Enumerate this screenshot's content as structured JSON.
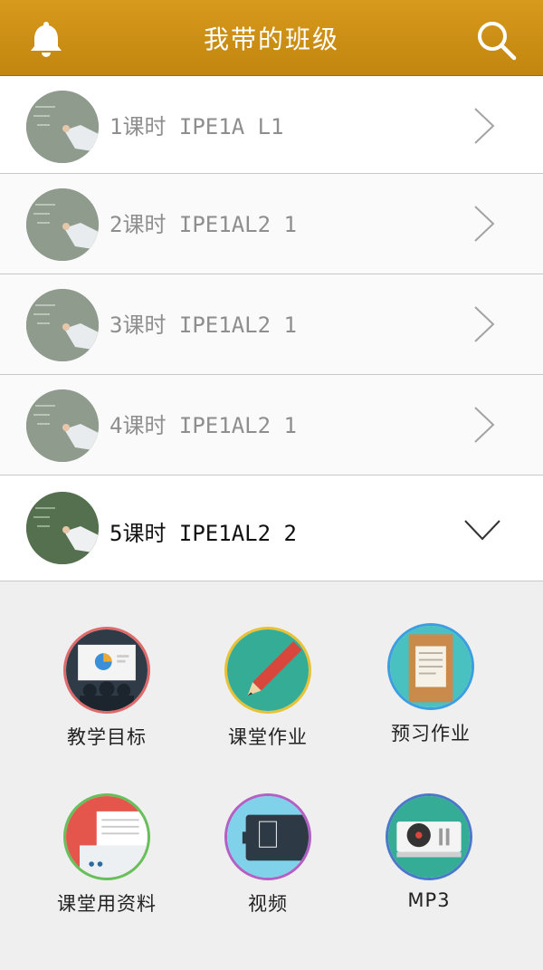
{
  "header": {
    "title": "我带的班级",
    "left_icon": "bell-icon",
    "right_icon": "search-icon"
  },
  "lessons": [
    {
      "label": "1课时 IPE1A L1",
      "state": "collapsed"
    },
    {
      "label": "2课时 IPE1AL2 1",
      "state": "collapsed"
    },
    {
      "label": "3课时 IPE1AL2 1",
      "state": "collapsed"
    },
    {
      "label": "4课时 IPE1AL2 1",
      "state": "collapsed"
    },
    {
      "label": "5课时 IPE1AL2 2",
      "state": "expanded"
    }
  ],
  "resources": [
    {
      "label": "教学目标",
      "icon": "presentation-icon",
      "ring": "#e06a6a"
    },
    {
      "label": "课堂作业",
      "icon": "pencil-icon",
      "ring": "#e8c234"
    },
    {
      "label": "预习作业",
      "icon": "scroll-icon",
      "ring": "#3b9ee0"
    },
    {
      "label": "课堂用资料",
      "icon": "printer-icon",
      "ring": "#66c05a"
    },
    {
      "label": "视频",
      "icon": "video-player-icon",
      "ring": "#b35fc4"
    },
    {
      "label": "MP3",
      "icon": "turntable-icon",
      "ring": "#4a79c9"
    }
  ],
  "colors": {
    "header": "#cc8f15",
    "row_text": "#8e8e8e",
    "active_text": "#111111"
  }
}
